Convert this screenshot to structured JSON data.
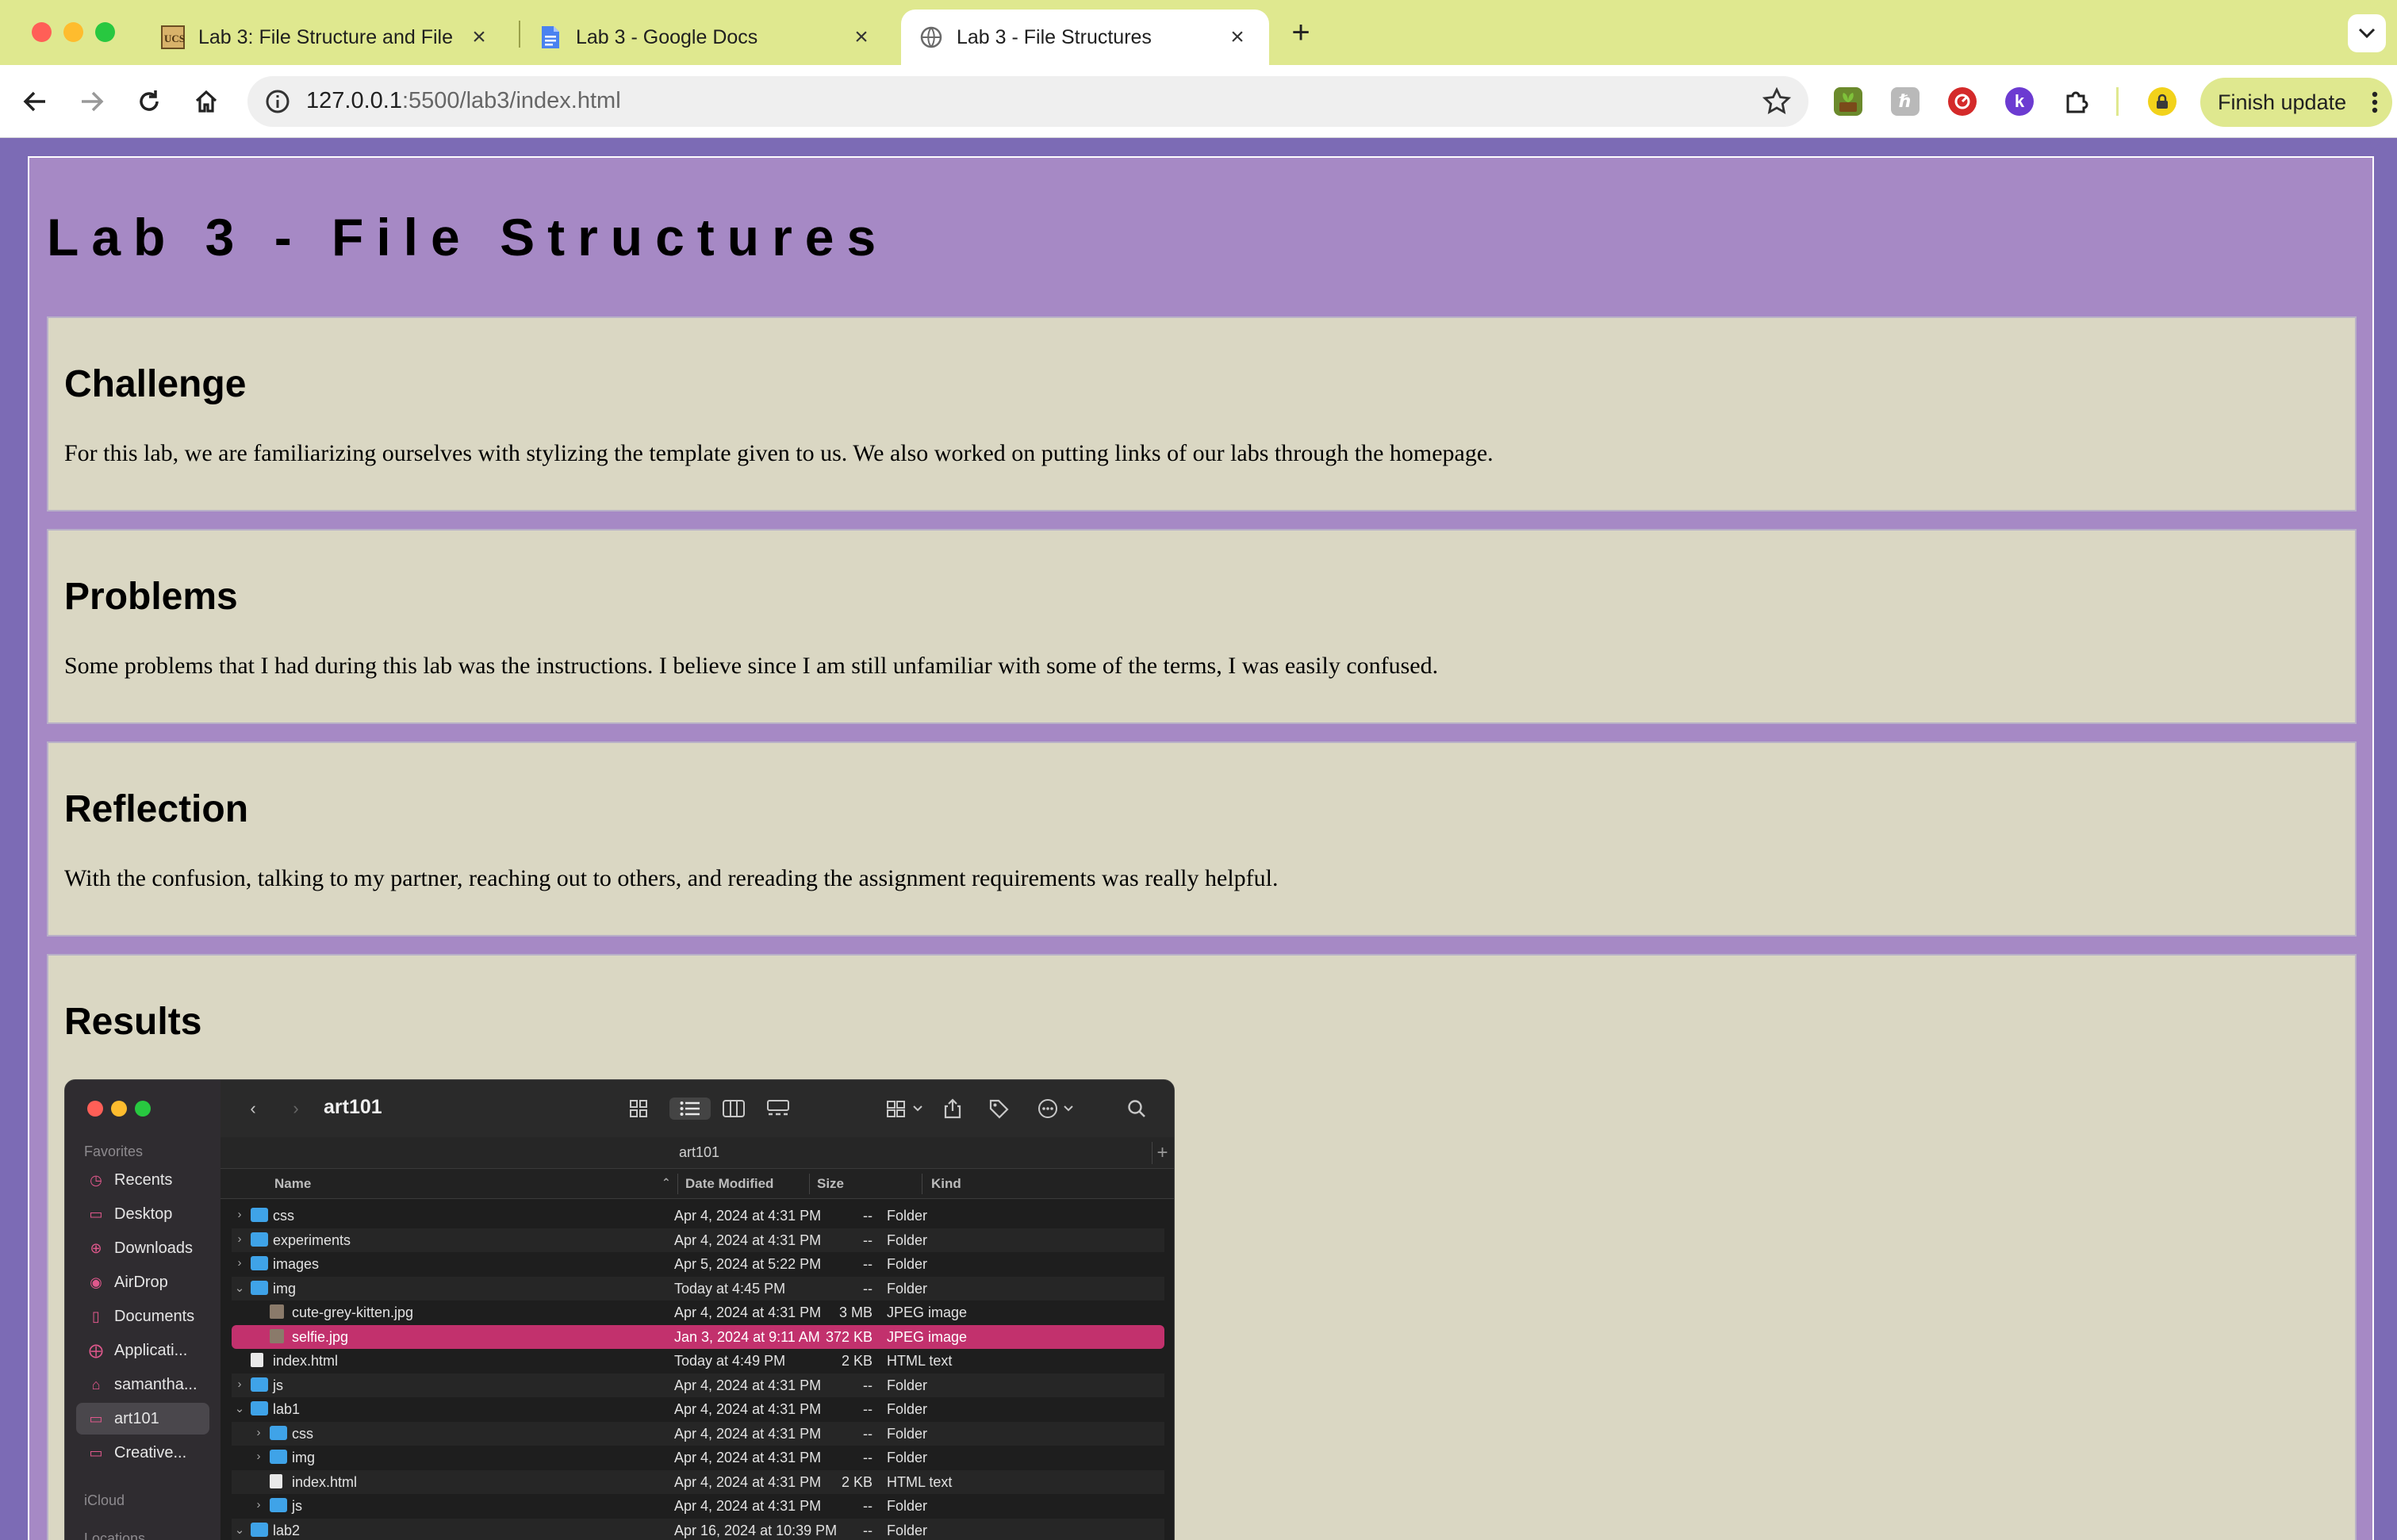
{
  "browser": {
    "tabs": [
      {
        "title": "Lab 3: File Structure and File",
        "active": false
      },
      {
        "title": "Lab 3 - Google Docs",
        "active": false
      },
      {
        "title": "Lab 3 - File Structures",
        "active": true
      }
    ],
    "new_tab": "+",
    "close_glyph": "×",
    "url_host": "127.0.0.1",
    "url_rest": ":5500/lab3/index.html",
    "finish_update_label": "Finish update",
    "accent": "#dfe88f"
  },
  "page": {
    "title": "Lab 3 - File Structures",
    "sections": [
      {
        "heading": "Challenge",
        "body": "For this lab, we are familiarizing ourselves with stylizing the template given to us. We also worked on putting links of our labs through the homepage."
      },
      {
        "heading": "Problems",
        "body": "Some problems that I had during this lab was the instructions. I believe since I am still unfamiliar with some of the terms, I was easily confused."
      },
      {
        "heading": "Reflection",
        "body": "With the confusion, talking to my partner, reaching out to others, and rereading the assignment requirements was really helpful."
      },
      {
        "heading": "Results",
        "body": ""
      }
    ],
    "colors": {
      "background": "#7c6bb5",
      "container": "#a689c5",
      "section": "#dad7c3"
    }
  },
  "finder": {
    "title": "art101",
    "path": "art101",
    "sidebar": {
      "favorites_label": "Favorites",
      "items": [
        {
          "label": "Recents",
          "icon": "clock-icon"
        },
        {
          "label": "Desktop",
          "icon": "desktop-icon"
        },
        {
          "label": "Downloads",
          "icon": "download-icon"
        },
        {
          "label": "AirDrop",
          "icon": "airdrop-icon"
        },
        {
          "label": "Documents",
          "icon": "document-icon"
        },
        {
          "label": "Applicati...",
          "icon": "applications-icon"
        },
        {
          "label": "samantha...",
          "icon": "home-icon"
        },
        {
          "label": "art101",
          "icon": "folder-icon",
          "selected": true
        },
        {
          "label": "Creative...",
          "icon": "folder-icon"
        }
      ],
      "icloud_label": "iCloud",
      "locations_label": "Locations"
    },
    "columns": {
      "name": "Name",
      "date": "Date Modified",
      "size": "Size",
      "kind": "Kind"
    },
    "rows": [
      {
        "name": "css",
        "date": "Apr 4, 2024 at 4:31 PM",
        "size": "--",
        "kind": "Folder",
        "type": "folder",
        "level": 0,
        "disclosure": "collapsed"
      },
      {
        "name": "experiments",
        "date": "Apr 4, 2024 at 4:31 PM",
        "size": "--",
        "kind": "Folder",
        "type": "folder",
        "level": 0,
        "disclosure": "collapsed"
      },
      {
        "name": "images",
        "date": "Apr 5, 2024 at 5:22 PM",
        "size": "--",
        "kind": "Folder",
        "type": "folder",
        "level": 0,
        "disclosure": "collapsed"
      },
      {
        "name": "img",
        "date": "Today at 4:45 PM",
        "size": "--",
        "kind": "Folder",
        "type": "folder",
        "level": 0,
        "disclosure": "expanded"
      },
      {
        "name": "cute-grey-kitten.jpg",
        "date": "Apr 4, 2024 at 4:31 PM",
        "size": "3 MB",
        "kind": "JPEG image",
        "type": "image",
        "level": 1,
        "disclosure": "none"
      },
      {
        "name": "selfie.jpg",
        "date": "Jan 3, 2024 at 9:11 AM",
        "size": "372 KB",
        "kind": "JPEG image",
        "type": "image",
        "level": 1,
        "disclosure": "none",
        "selected": true
      },
      {
        "name": "index.html",
        "date": "Today at 4:49 PM",
        "size": "2 KB",
        "kind": "HTML text",
        "type": "file",
        "level": 0,
        "disclosure": "none"
      },
      {
        "name": "js",
        "date": "Apr 4, 2024 at 4:31 PM",
        "size": "--",
        "kind": "Folder",
        "type": "folder",
        "level": 0,
        "disclosure": "collapsed"
      },
      {
        "name": "lab1",
        "date": "Apr 4, 2024 at 4:31 PM",
        "size": "--",
        "kind": "Folder",
        "type": "folder",
        "level": 0,
        "disclosure": "expanded"
      },
      {
        "name": "css",
        "date": "Apr 4, 2024 at 4:31 PM",
        "size": "--",
        "kind": "Folder",
        "type": "folder",
        "level": 1,
        "disclosure": "collapsed"
      },
      {
        "name": "img",
        "date": "Apr 4, 2024 at 4:31 PM",
        "size": "--",
        "kind": "Folder",
        "type": "folder",
        "level": 1,
        "disclosure": "collapsed"
      },
      {
        "name": "index.html",
        "date": "Apr 4, 2024 at 4:31 PM",
        "size": "2 KB",
        "kind": "HTML text",
        "type": "file",
        "level": 1,
        "disclosure": "none"
      },
      {
        "name": "js",
        "date": "Apr 4, 2024 at 4:31 PM",
        "size": "--",
        "kind": "Folder",
        "type": "folder",
        "level": 1,
        "disclosure": "collapsed"
      },
      {
        "name": "lab2",
        "date": "Apr 16, 2024 at 10:39 PM",
        "size": "--",
        "kind": "Folder",
        "type": "folder",
        "level": 0,
        "disclosure": "expanded"
      }
    ]
  }
}
